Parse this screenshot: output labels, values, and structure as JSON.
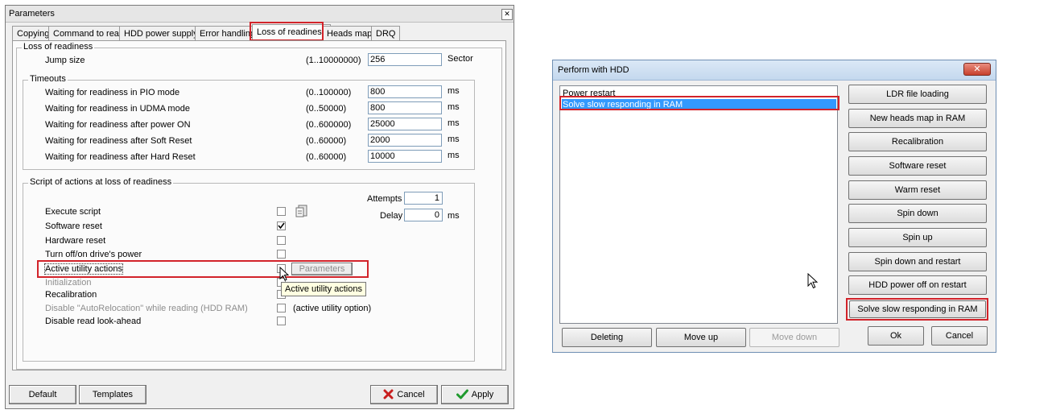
{
  "params_window": {
    "title": "Parameters",
    "close_glyph": "✕",
    "tabs": [
      {
        "label": "Copying"
      },
      {
        "label": "Command to read"
      },
      {
        "label": "HDD power supply"
      },
      {
        "label": "Error handling"
      },
      {
        "label": "Loss of readiness"
      },
      {
        "label": "Heads map"
      },
      {
        "label": "DRQ"
      }
    ],
    "loss_group": {
      "title": "Loss of readiness",
      "jump_label": "Jump size",
      "jump_range": "(1..10000000)",
      "jump_value": "256",
      "jump_unit": "Sector"
    },
    "timeouts": {
      "title": "Timeouts",
      "rows": [
        {
          "label": "Waiting for readiness in PIO mode",
          "range": "(0..100000)",
          "value": "800",
          "unit": "ms"
        },
        {
          "label": "Waiting for readiness in UDMA mode",
          "range": "(0..50000)",
          "value": "800",
          "unit": "ms"
        },
        {
          "label": "Waiting for readiness after power ON",
          "range": "(0..600000)",
          "value": "25000",
          "unit": "ms"
        },
        {
          "label": "Waiting for readiness after Soft Reset",
          "range": "(0..60000)",
          "value": "2000",
          "unit": "ms"
        },
        {
          "label": "Waiting for readiness after Hard Reset",
          "range": "(0..60000)",
          "value": "10000",
          "unit": "ms"
        }
      ]
    },
    "script_group": {
      "title": "Script of actions at loss of readiness",
      "attempts_label": "Attempts",
      "attempts_value": "1",
      "delay_label": "Delay",
      "delay_value": "0",
      "delay_unit": "ms",
      "items": [
        {
          "label": "Execute script",
          "checked": false,
          "disabled": false
        },
        {
          "label": "Software reset",
          "checked": true,
          "disabled": false
        },
        {
          "label": "Hardware reset",
          "checked": false,
          "disabled": false
        },
        {
          "label": "Turn off/on drive's power",
          "checked": false,
          "disabled": false
        },
        {
          "label": "Active utility actions",
          "checked": false,
          "disabled": false
        },
        {
          "label": "Initialization",
          "checked": false,
          "disabled": true
        },
        {
          "label": "Recalibration",
          "checked": false,
          "disabled": false
        },
        {
          "label": "Disable \"AutoRelocation\" while reading (HDD RAM)",
          "checked": false,
          "disabled": true
        },
        {
          "label": "Disable read look-ahead",
          "checked": false,
          "disabled": false
        }
      ],
      "parameters_button": "Parameters",
      "tooltip": "Active utility actions",
      "active_option_note": "(active utility option)"
    },
    "footer": {
      "default_label": "Default",
      "templates_label": "Templates",
      "cancel_label": "Cancel",
      "apply_label": "Apply"
    }
  },
  "hdd_window": {
    "title": "Perform with HDD",
    "close_glyph": "✕",
    "list_items": [
      {
        "label": "Power restart",
        "selected": false
      },
      {
        "label": "Solve slow responding in RAM",
        "selected": true
      }
    ],
    "side_buttons": [
      {
        "label": "LDR file loading"
      },
      {
        "label": "New heads map in RAM"
      },
      {
        "label": "Recalibration"
      },
      {
        "label": "Software reset"
      },
      {
        "label": "Warm reset"
      },
      {
        "label": "Spin down"
      },
      {
        "label": "Spin up"
      },
      {
        "label": "Spin down and restart"
      },
      {
        "label": "HDD power off on restart"
      },
      {
        "label": "Solve slow responding in RAM"
      }
    ],
    "bottom_buttons": {
      "deleting_label": "Deleting",
      "move_up_label": "Move up",
      "move_down_label": "Move down",
      "ok_label": "Ok",
      "cancel_label": "Cancel"
    }
  },
  "colors": {
    "highlight_red": "#d2232a",
    "selection_blue": "#3399ff",
    "cancel_red": "#c81e1e",
    "apply_green": "#1f9a2e"
  }
}
